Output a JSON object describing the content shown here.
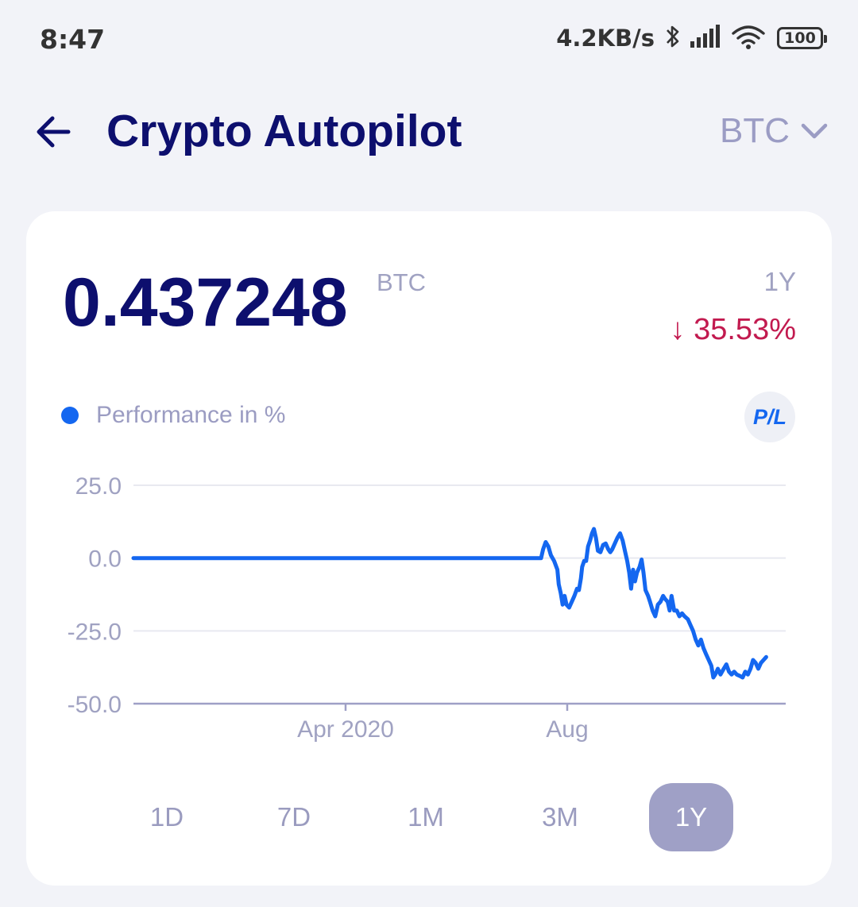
{
  "status_bar": {
    "time": "8:47",
    "net_speed": "4.2KB/s",
    "battery": "100",
    "icons": [
      "bluetooth-icon",
      "signal-icon",
      "wifi-icon",
      "battery-icon"
    ]
  },
  "header": {
    "title": "Crypto Autopilot",
    "currency": "BTC",
    "icons": [
      "back-arrow-icon",
      "chevron-down-icon"
    ]
  },
  "summary": {
    "value": "0.437248",
    "unit": "BTC",
    "period": "1Y",
    "change": "↓ 35.53%",
    "change_color": "#c21a4f"
  },
  "legend": {
    "label": "Performance in %",
    "color": "#1467f0",
    "toggle": "P/L"
  },
  "range_tabs": [
    "1D",
    "7D",
    "1M",
    "3M",
    "1Y"
  ],
  "active_range": "1Y",
  "chart_data": {
    "type": "line",
    "y_ticks": [
      "25.0",
      "0.0",
      "-25.0",
      "-50.0"
    ],
    "ylim": [
      -50,
      25
    ],
    "x_ticks": [
      "Apr 2020",
      "Aug"
    ],
    "grid": true,
    "series": [
      {
        "name": "Performance in %",
        "color": "#1467f0",
        "points": [
          [
            0.0,
            0
          ],
          [
            0.62,
            0
          ],
          [
            0.625,
            0
          ],
          [
            0.628,
            3
          ],
          [
            0.632,
            5.5
          ],
          [
            0.636,
            4
          ],
          [
            0.64,
            1
          ],
          [
            0.645,
            -1
          ],
          [
            0.65,
            -4
          ],
          [
            0.652,
            -9
          ],
          [
            0.655,
            -12
          ],
          [
            0.658,
            -16
          ],
          [
            0.661,
            -13
          ],
          [
            0.664,
            -16
          ],
          [
            0.668,
            -17
          ],
          [
            0.672,
            -15
          ],
          [
            0.676,
            -13
          ],
          [
            0.68,
            -10.5
          ],
          [
            0.683,
            -11
          ],
          [
            0.686,
            -7
          ],
          [
            0.688,
            -3
          ],
          [
            0.691,
            -1
          ],
          [
            0.694,
            -1
          ],
          [
            0.697,
            4
          ],
          [
            0.7,
            6
          ],
          [
            0.703,
            8.5
          ],
          [
            0.706,
            10
          ],
          [
            0.709,
            7
          ],
          [
            0.712,
            2.5
          ],
          [
            0.716,
            2
          ],
          [
            0.72,
            4.5
          ],
          [
            0.724,
            5
          ],
          [
            0.728,
            3
          ],
          [
            0.731,
            2
          ],
          [
            0.734,
            3
          ],
          [
            0.738,
            5
          ],
          [
            0.742,
            7
          ],
          [
            0.746,
            8.5
          ],
          [
            0.75,
            6
          ],
          [
            0.754,
            2
          ],
          [
            0.757,
            -1
          ],
          [
            0.76,
            -5
          ],
          [
            0.763,
            -10.5
          ],
          [
            0.766,
            -4
          ],
          [
            0.769,
            -8
          ],
          [
            0.772,
            -5
          ],
          [
            0.776,
            -3
          ],
          [
            0.779,
            -0.5
          ],
          [
            0.782,
            -5
          ],
          [
            0.785,
            -11
          ],
          [
            0.789,
            -13
          ],
          [
            0.792,
            -15
          ],
          [
            0.796,
            -18
          ],
          [
            0.8,
            -20
          ],
          [
            0.804,
            -16
          ],
          [
            0.808,
            -15
          ],
          [
            0.812,
            -13
          ],
          [
            0.815,
            -14
          ],
          [
            0.819,
            -15
          ],
          [
            0.822,
            -18
          ],
          [
            0.825,
            -13
          ],
          [
            0.829,
            -18
          ],
          [
            0.833,
            -18
          ],
          [
            0.837,
            -20
          ],
          [
            0.841,
            -19
          ],
          [
            0.845,
            -20
          ],
          [
            0.85,
            -21
          ],
          [
            0.854,
            -23
          ],
          [
            0.858,
            -25
          ],
          [
            0.862,
            -28
          ],
          [
            0.866,
            -30
          ],
          [
            0.87,
            -28
          ],
          [
            0.874,
            -31
          ],
          [
            0.878,
            -33
          ],
          [
            0.882,
            -35
          ],
          [
            0.886,
            -37
          ],
          [
            0.889,
            -41
          ],
          [
            0.892,
            -40
          ],
          [
            0.896,
            -38
          ],
          [
            0.9,
            -40
          ],
          [
            0.905,
            -38
          ],
          [
            0.909,
            -36.5
          ],
          [
            0.913,
            -39
          ],
          [
            0.917,
            -40
          ],
          [
            0.921,
            -39
          ],
          [
            0.925,
            -40
          ],
          [
            0.93,
            -40.5
          ],
          [
            0.934,
            -41
          ],
          [
            0.938,
            -39
          ],
          [
            0.942,
            -40
          ],
          [
            0.946,
            -38
          ],
          [
            0.95,
            -35
          ],
          [
            0.954,
            -36
          ],
          [
            0.958,
            -38
          ],
          [
            0.962,
            -36
          ],
          [
            0.966,
            -35
          ],
          [
            0.97,
            -34
          ]
        ]
      }
    ]
  }
}
